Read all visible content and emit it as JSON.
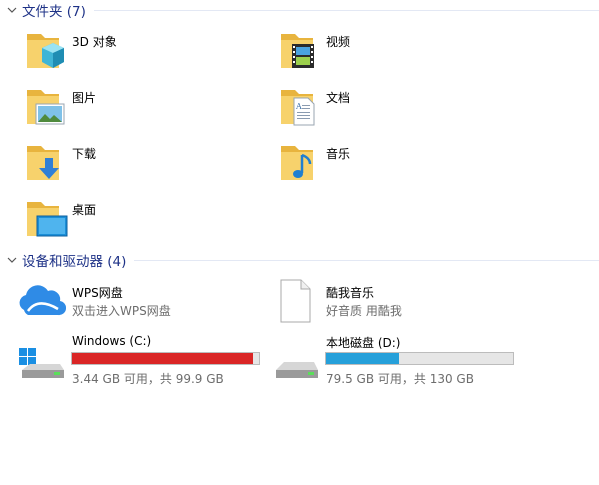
{
  "folders_group": {
    "title": "文件夹 (7)",
    "items": [
      {
        "label": "3D 对象",
        "icon": "3d-objects-folder-icon"
      },
      {
        "label": "视频",
        "icon": "videos-folder-icon"
      },
      {
        "label": "图片",
        "icon": "pictures-folder-icon"
      },
      {
        "label": "文档",
        "icon": "documents-folder-icon"
      },
      {
        "label": "下载",
        "icon": "downloads-folder-icon"
      },
      {
        "label": "音乐",
        "icon": "music-folder-icon"
      },
      {
        "label": "桌面",
        "icon": "desktop-folder-icon"
      }
    ]
  },
  "devices_group": {
    "title": "设备和驱动器 (4)",
    "wps": {
      "label": "WPS网盘",
      "sub": "双击进入WPS网盘",
      "icon": "cloud-icon"
    },
    "kuwo": {
      "label": "酷我音乐",
      "sub": "好音质 用酷我",
      "icon": "blank-file-icon"
    },
    "drive_c": {
      "label": "Windows (C:)",
      "free": "3.44 GB 可用，共 99.9 GB",
      "used_fraction": 0.966,
      "bar_color": "#da2626",
      "icon": "windows-drive-icon"
    },
    "drive_d": {
      "label": "本地磁盘 (D:)",
      "free": "79.5 GB 可用，共 130 GB",
      "used_fraction": 0.388,
      "bar_color": "#26a0da",
      "icon": "hard-drive-icon"
    }
  },
  "colors": {
    "group_title": "#1e3287",
    "folder_body": "#f7d26c",
    "folder_back": "#e8b43e"
  }
}
